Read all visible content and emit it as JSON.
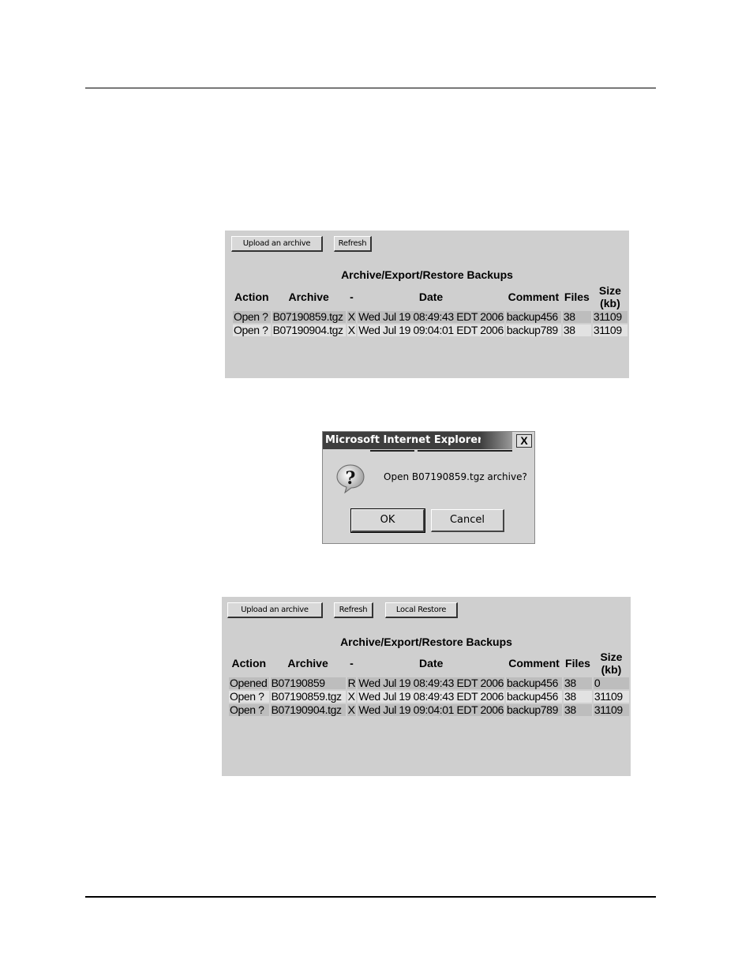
{
  "panel1": {
    "buttons": {
      "upload": "Upload an archive",
      "refresh": "Refresh"
    },
    "title": "Archive/Export/Restore Backups",
    "columns": [
      "Action",
      "Archive",
      "-",
      "Date",
      "Comment",
      "Files",
      "Size (kb)"
    ],
    "rows": [
      {
        "action": "Open ?",
        "archive": "B07190859.tgz",
        "flag": "X",
        "date": "Wed Jul 19 08:49:43 EDT 2006",
        "comment": "backup456",
        "files": "38",
        "size": "31109"
      },
      {
        "action": "Open ?",
        "archive": "B07190904.tgz",
        "flag": "X",
        "date": "Wed Jul 19 09:04:01 EDT 2006",
        "comment": "backup789",
        "files": "38",
        "size": "31109"
      }
    ]
  },
  "dialog": {
    "title": "Microsoft Internet Explorer",
    "close": "X",
    "message": "Open B07190859.tgz archive?",
    "icon": "question-icon",
    "ok": "OK",
    "cancel": "Cancel"
  },
  "panel2": {
    "buttons": {
      "upload": "Upload an archive",
      "refresh": "Refresh",
      "local_restore": "Local Restore"
    },
    "title": "Archive/Export/Restore Backups",
    "columns": [
      "Action",
      "Archive",
      "-",
      "Date",
      "Comment",
      "Files",
      "Size (kb)"
    ],
    "rows": [
      {
        "action": "Opened",
        "archive": "B07190859",
        "flag": "R",
        "date": "Wed Jul 19 08:49:43 EDT 2006",
        "comment": "backup456",
        "files": "38",
        "size": "0"
      },
      {
        "action": "Open ?",
        "archive": "B07190859.tgz",
        "flag": "X",
        "date": "Wed Jul 19 08:49:43 EDT 2006",
        "comment": "backup456",
        "files": "38",
        "size": "31109"
      },
      {
        "action": "Open ?",
        "archive": "B07190904.tgz",
        "flag": "X",
        "date": "Wed Jul 19 09:04:01 EDT 2006",
        "comment": "backup789",
        "files": "38",
        "size": "31109"
      }
    ]
  }
}
